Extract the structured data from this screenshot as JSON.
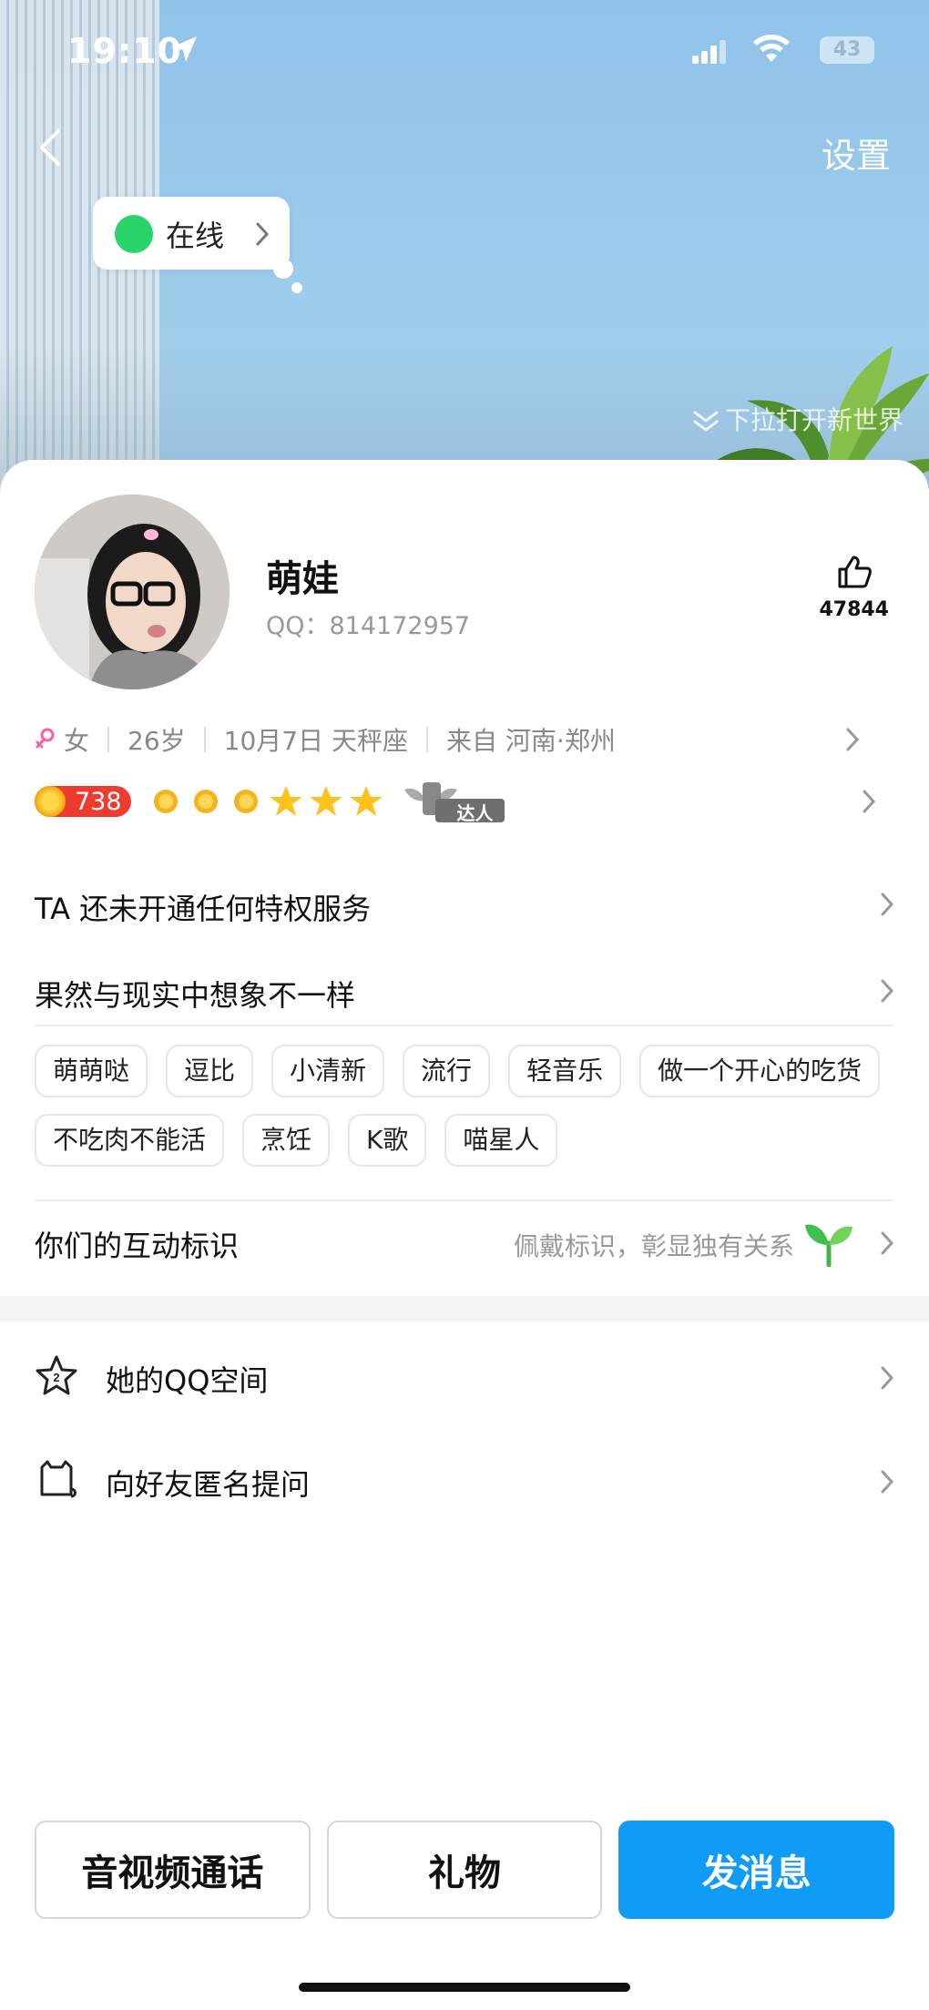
{
  "status_bar": {
    "time": "19:10",
    "battery": "43"
  },
  "header": {
    "settings_label": "设置"
  },
  "online_bubble": {
    "label": "在线"
  },
  "pull_hint": "下拉打开新世界",
  "profile": {
    "name": "萌娃",
    "qq_label": "QQ：814172957",
    "likes": "47844",
    "gender": "女",
    "age": "26岁",
    "birthday": "10月7日 天秤座",
    "location": "来自 河南·郑州",
    "level": "738",
    "badge_text": "达人"
  },
  "menu": {
    "privilege": "TA 还未开通任何特权服务",
    "signature": "果然与现实中想象不一样"
  },
  "tags": [
    "萌萌哒",
    "逗比",
    "小清新",
    "流行",
    "轻音乐",
    "做一个开心的吃货",
    "不吃肉不能活",
    "烹饪",
    "K歌",
    "喵星人"
  ],
  "interaction": {
    "title": "你们的互动标识",
    "subtitle": "佩戴标识，彰显独有关系"
  },
  "list": [
    {
      "label": "她的QQ空间",
      "icon": "star-icon"
    },
    {
      "label": "向好友匿名提问",
      "icon": "cat-icon"
    }
  ],
  "actions": {
    "call": "音视频通话",
    "gift": "礼物",
    "message": "发消息"
  },
  "colors": {
    "primary": "#109bf7",
    "online": "#2bd36b",
    "level_badge": "#ee3b2f"
  }
}
